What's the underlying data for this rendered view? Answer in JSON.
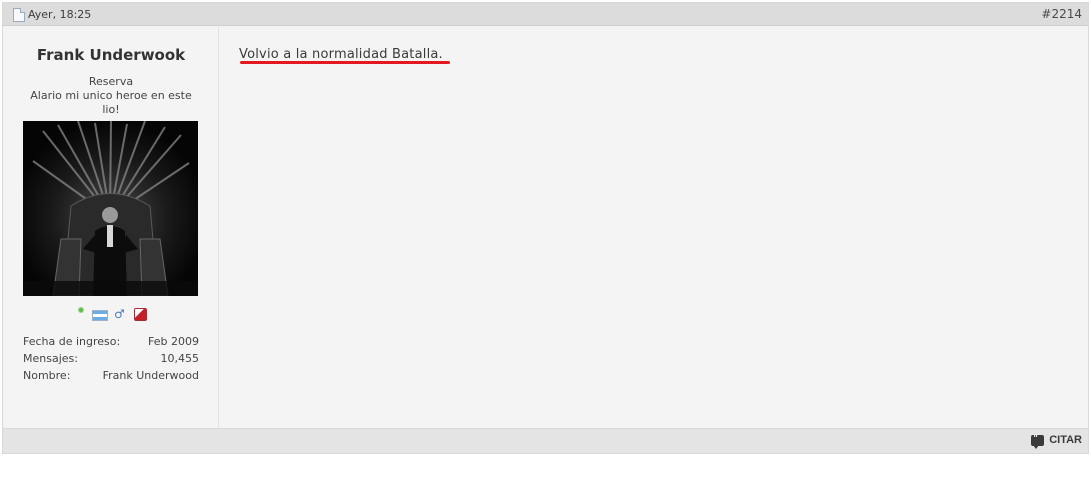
{
  "post": {
    "date": "Ayer, 18:25",
    "number": "#2214",
    "message": "Volvio a la normalidad Batalla.",
    "highlight_color": "#e3191f"
  },
  "user": {
    "name": "Frank Underwook",
    "rank": "Reserva",
    "title": "Alario mi unico heroe en este lio!",
    "avatar_icon": "iron-throne-avatar",
    "status_icons": [
      "online-icon",
      "argentina-flag-icon",
      "male-icon",
      "reputation-icon"
    ],
    "stats": [
      {
        "label": "Fecha de ingreso:",
        "value": "Feb 2009"
      },
      {
        "label": "Mensajes:",
        "value": "10,455"
      },
      {
        "label": "Nombre:",
        "value": "Frank Underwood"
      }
    ]
  },
  "footer": {
    "quote_label": "CITAR",
    "quote_icon": "quote-bubble-icon"
  }
}
